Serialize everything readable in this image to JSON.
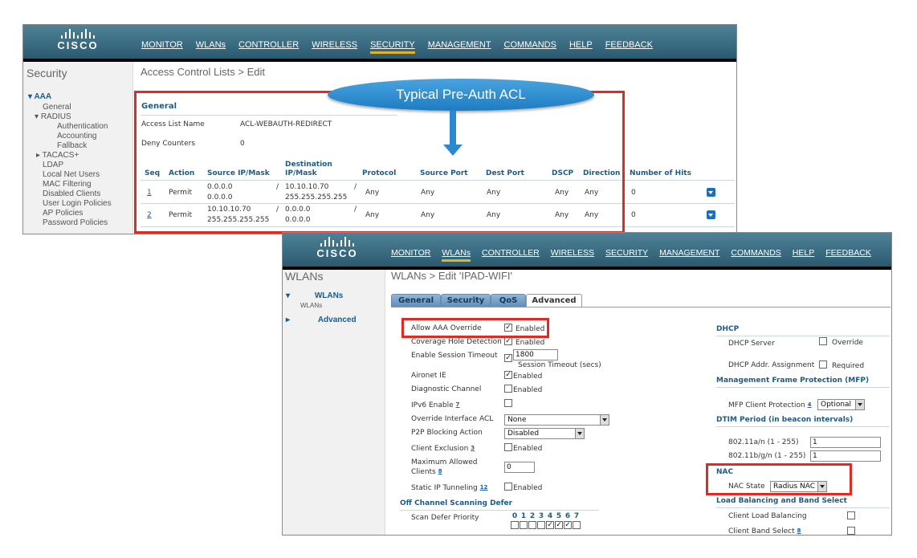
{
  "brand": "CISCO",
  "callout": "Typical Pre-Auth ACL",
  "acl": {
    "nav": [
      "MONITOR",
      "WLANs",
      "CONTROLLER",
      "WIRELESS",
      "SECURITY",
      "MANAGEMENT",
      "COMMANDS",
      "HELP",
      "FEEDBACK"
    ],
    "active_nav": "SECURITY",
    "sidebar": {
      "title": "Security",
      "items": [
        "AAA",
        "General",
        "RADIUS",
        "Authentication",
        "Accounting",
        "Fallback",
        "TACACS+",
        "LDAP",
        "Local Net Users",
        "MAC Filtering",
        "Disabled Clients",
        "User Login Policies",
        "AP Policies",
        "Password Policies"
      ]
    },
    "page_title": "Access Control Lists > Edit",
    "section": "General",
    "fields": [
      {
        "label": "Access List Name",
        "value": "ACL-WEBAUTH-REDIRECT"
      },
      {
        "label": "Deny Counters",
        "value": "0"
      }
    ],
    "columns": [
      "Seq",
      "Action",
      "Source IP/Mask",
      "Destination\nIP/Mask",
      "Protocol",
      "Source Port",
      "Dest Port",
      "DSCP",
      "Direction",
      "Number of Hits"
    ],
    "rows": [
      {
        "seq": "1",
        "action": "Permit",
        "src1": "0.0.0.0",
        "src2": "0.0.0.0",
        "sep": "/",
        "dst1": "10.10.10.70",
        "dst2": "255.255.255.255",
        "sep2": "/",
        "protocol": "Any",
        "sport": "Any",
        "dport": "Any",
        "dscp": "Any",
        "direction": "Any",
        "hits": "0"
      },
      {
        "seq": "2",
        "action": "Permit",
        "src1": "10.10.10.70",
        "src2": "255.255.255.255",
        "sep": "/",
        "dst1": "0.0.0.0",
        "dst2": "0.0.0.0",
        "sep2": "/",
        "protocol": "Any",
        "sport": "Any",
        "dport": "Any",
        "dscp": "Any",
        "direction": "Any",
        "hits": "0"
      }
    ]
  },
  "wlan": {
    "nav": [
      "MONITOR",
      "WLANs",
      "CONTROLLER",
      "WIRELESS",
      "SECURITY",
      "MANAGEMENT",
      "COMMANDS",
      "HELP",
      "FEEDBACK"
    ],
    "active_nav": "WLANs",
    "sidebar": {
      "title": "WLANs",
      "items": [
        "WLANs",
        "WLANs",
        "Advanced"
      ]
    },
    "page_title": "WLANs > Edit  'IPAD-WIFI'",
    "tabs": [
      "General",
      "Security",
      "QoS",
      "Advanced"
    ],
    "active_tab": "Advanced",
    "enabled": "Enabled",
    "left": {
      "allow_aaa": "Allow AAA Override",
      "coverage": "Coverage Hole Detection",
      "session_timeout": "Enable Session Timeout",
      "session_value": "1800",
      "session_note": "Session Timeout (secs)",
      "aironet": "Aironet IE",
      "diagnostic": "Diagnostic Channel",
      "ipv6": "IPv6 Enable",
      "ipv6_sup": "7",
      "override_acl": "Override Interface ACL",
      "override_value": "None",
      "p2p": "P2P Blocking Action",
      "p2p_value": "Disabled",
      "client_excl": "Client Exclusion",
      "client_excl_sup": "3",
      "max_clients_1": "Maximum Allowed",
      "max_clients_2": "Clients",
      "max_clients_sup": "8",
      "max_clients_value": "0",
      "static_ip": "Static IP Tunneling",
      "static_ip_sup": "12",
      "off_channel": "Off Channel Scanning Defer",
      "scan_defer": "Scan Defer Priority",
      "priorities": [
        "0",
        "1",
        "2",
        "3",
        "4",
        "5",
        "6",
        "7"
      ],
      "priority_checked": [
        false,
        false,
        false,
        false,
        true,
        true,
        true,
        false
      ]
    },
    "right": {
      "dhcp": "DHCP",
      "dhcp_server": "DHCP Server",
      "override": "Override",
      "dhcp_addr": "DHCP Addr. Assignment",
      "required": "Required",
      "mfp": "Management Frame Protection (MFP)",
      "mfp_client": "MFP Client Protection",
      "mfp_sup": "4",
      "mfp_value": "Optional",
      "dtim": "DTIM Period (in beacon intervals)",
      "dtim_a": "802.11a/n (1 - 255)",
      "dtim_a_value": "1",
      "dtim_bg": "802.11b/g/n (1 - 255)",
      "dtim_bg_value": "1",
      "nac": "NAC",
      "nac_state": "NAC State",
      "nac_value": "Radius NAC",
      "lb": "Load Balancing and Band Select",
      "client_lb": "Client Load Balancing",
      "client_bs": "Client Band Select",
      "client_bs_sup": "8"
    }
  }
}
